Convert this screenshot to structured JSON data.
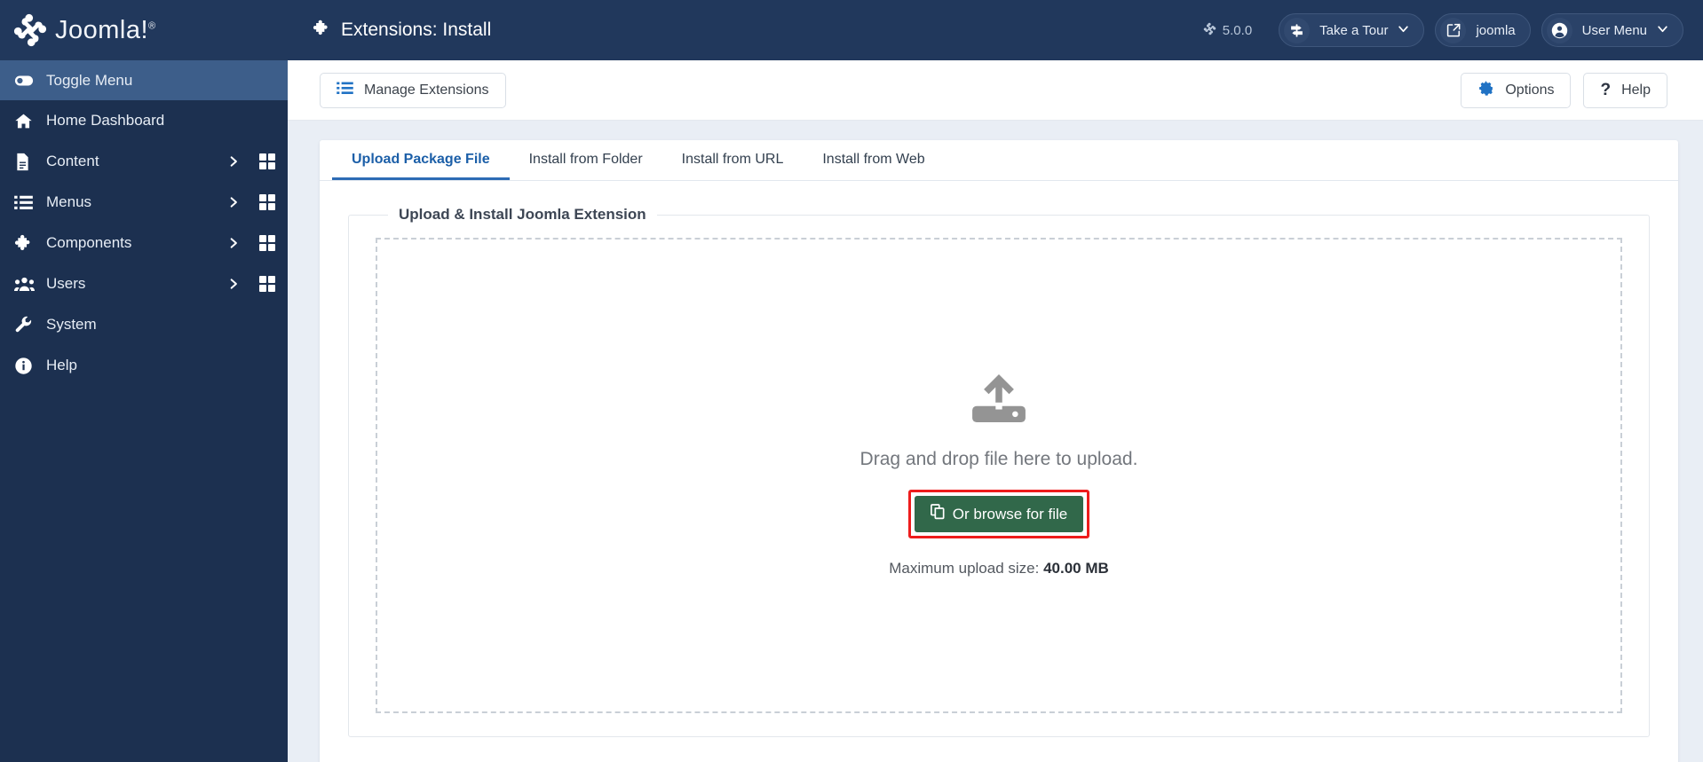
{
  "brand": {
    "name": "Joomla!",
    "trademark": "®",
    "logo_icon": "joomla-logo-icon"
  },
  "sidebar": {
    "items": [
      {
        "label": "Toggle Menu",
        "icon": "toggle-switch-icon",
        "active": true,
        "has_chevron": false,
        "has_grid": false
      },
      {
        "label": "Home Dashboard",
        "icon": "home-icon",
        "active": false,
        "has_chevron": false,
        "has_grid": false
      },
      {
        "label": "Content",
        "icon": "document-icon",
        "active": false,
        "has_chevron": true,
        "has_grid": true
      },
      {
        "label": "Menus",
        "icon": "list-icon",
        "active": false,
        "has_chevron": true,
        "has_grid": true
      },
      {
        "label": "Components",
        "icon": "puzzle-icon",
        "active": false,
        "has_chevron": true,
        "has_grid": true
      },
      {
        "label": "Users",
        "icon": "users-icon",
        "active": false,
        "has_chevron": true,
        "has_grid": true
      },
      {
        "label": "System",
        "icon": "wrench-icon",
        "active": false,
        "has_chevron": false,
        "has_grid": false
      },
      {
        "label": "Help",
        "icon": "info-circle-icon",
        "active": false,
        "has_chevron": false,
        "has_grid": false
      }
    ]
  },
  "header": {
    "title": "Extensions: Install",
    "title_icon": "puzzle-icon",
    "version": "5.0.0",
    "version_icon": "joomla-mark-icon",
    "take_a_tour": {
      "label": "Take a Tour",
      "icon": "signpost-icon",
      "caret": "chevron-down-icon"
    },
    "site_link": {
      "label": "joomla",
      "icon": "external-link-icon"
    },
    "user_menu": {
      "label": "User Menu",
      "icon": "user-circle-icon",
      "caret": "chevron-down-icon"
    }
  },
  "toolbar": {
    "manage_extensions": {
      "label": "Manage Extensions",
      "icon": "list-icon"
    },
    "options": {
      "label": "Options",
      "icon": "gear-icon"
    },
    "help": {
      "label": "Help",
      "icon": "question-mark-icon"
    }
  },
  "tabs": [
    {
      "label": "Upload Package File",
      "active": true
    },
    {
      "label": "Install from Folder",
      "active": false
    },
    {
      "label": "Install from URL",
      "active": false
    },
    {
      "label": "Install from Web",
      "active": false
    }
  ],
  "upload_panel": {
    "legend": "Upload & Install Joomla Extension",
    "upload_icon": "upload-icon",
    "drop_text": "Drag and drop file here to upload.",
    "browse_button": {
      "label": "Or browse for file",
      "icon": "copy-files-icon"
    },
    "max_upload_label": "Maximum upload size:",
    "max_upload_value": "40.00 MB"
  },
  "colors": {
    "sidebar_bg": "#1c3050",
    "header_bg": "#21385c",
    "sidebar_active": "#3d5e8a",
    "accent_blue": "#2d6cb5",
    "icon_blue": "#2072c4",
    "browse_green": "#31684a",
    "highlight_red": "#ee1c1c",
    "page_bg": "#e9eef5"
  }
}
